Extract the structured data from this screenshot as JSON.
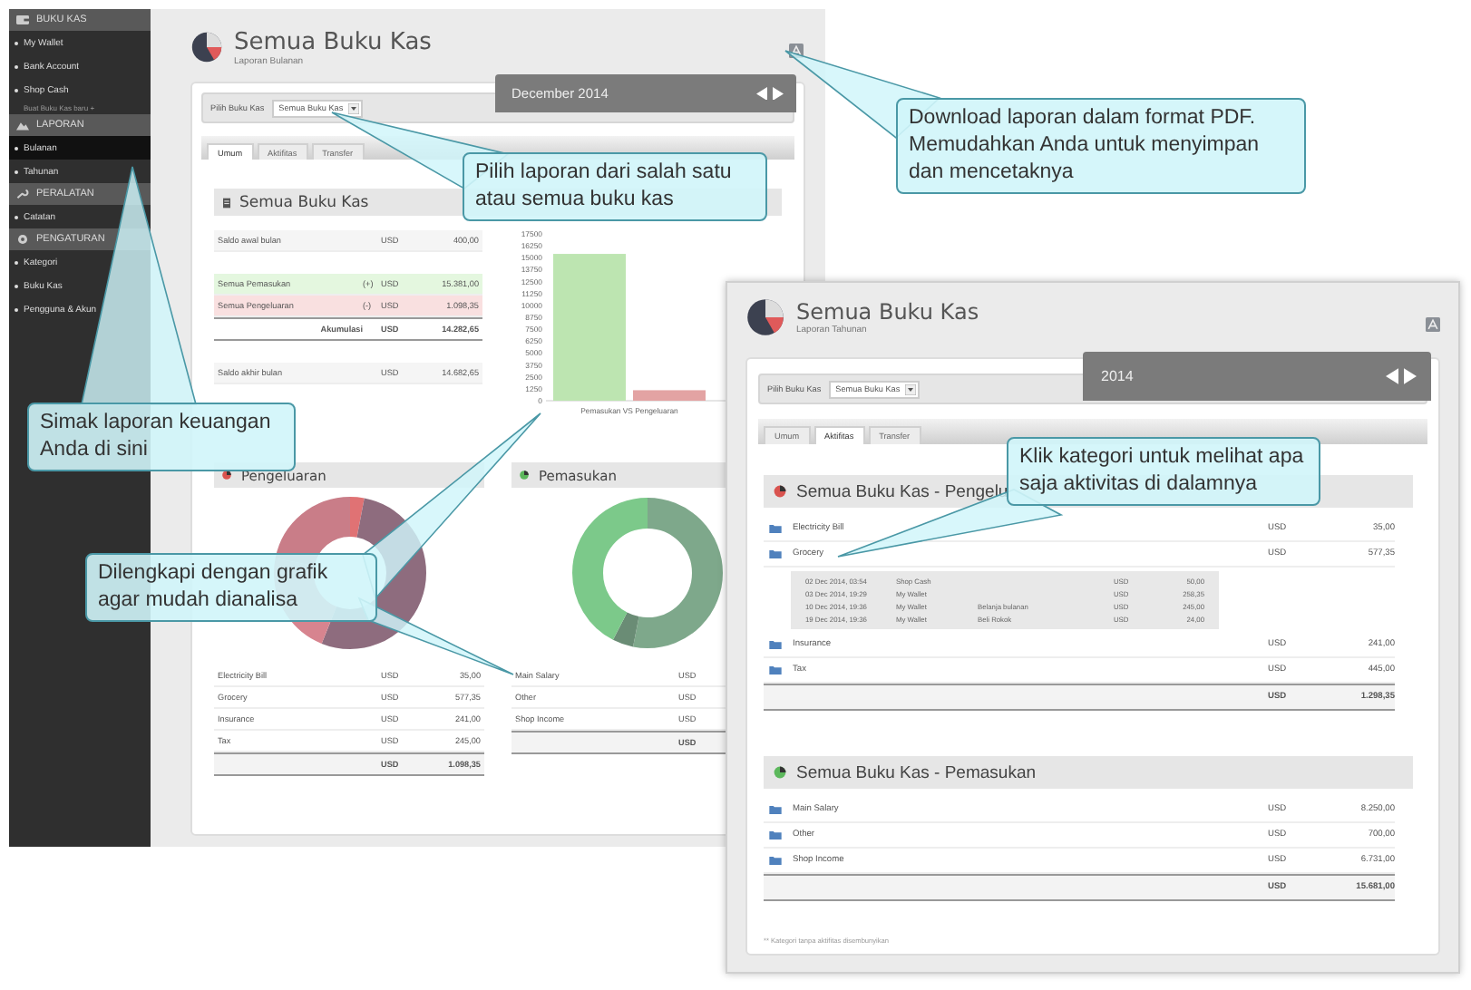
{
  "monthly_report": {
    "sidebar": [
      {
        "title": "BUKU KAS",
        "items": [
          {
            "label": "My Wallet",
            "kind": "link",
            "selected": false
          },
          {
            "label": "Bank Account",
            "kind": "link",
            "selected": false
          },
          {
            "label": "Shop Cash",
            "kind": "link",
            "selected": false
          },
          {
            "label": "Buat Buku Kas baru +",
            "kind": "add",
            "selected": false
          }
        ]
      },
      {
        "title": "LAPORAN",
        "items": [
          {
            "label": "Bulanan",
            "kind": "link",
            "selected": true
          },
          {
            "label": "Tahunan",
            "kind": "link",
            "selected": false
          }
        ]
      },
      {
        "title": "PERALATAN",
        "items": [
          {
            "label": "Catatan",
            "kind": "link",
            "selected": false
          }
        ]
      },
      {
        "title": "PENGATURAN",
        "items": [
          {
            "label": "Kategori",
            "kind": "link",
            "selected": false
          },
          {
            "label": "Buku Kas",
            "kind": "link",
            "selected": false
          },
          {
            "label": "Pengguna & Akun",
            "kind": "link",
            "selected": false
          }
        ]
      }
    ],
    "header": {
      "title": "Semua Buku Kas",
      "subtitle": "Laporan Bulanan"
    },
    "filter": {
      "label": "Pilih Buku Kas",
      "value": "Semua Buku Kas"
    },
    "period": "December 2014",
    "tabs": [
      {
        "label": "Umum",
        "selected": true
      },
      {
        "label": "Aktifitas",
        "selected": false
      },
      {
        "label": "Transfer",
        "selected": false
      }
    ],
    "summary": {
      "title": "Semua Buku Kas",
      "rows": [
        {
          "kind": "opening",
          "label": "Saldo awal bulan",
          "currency": "USD",
          "amount": "400,00"
        },
        {
          "kind": "income",
          "label": "Semua Pemasukan",
          "sign": "(+)",
          "currency": "USD",
          "amount": "15.381,00"
        },
        {
          "kind": "expense",
          "label": "Semua Pengeluaran",
          "sign": "(-)",
          "currency": "USD",
          "amount": "1.098,35"
        },
        {
          "kind": "total",
          "label": "Akumulasi",
          "currency": "USD",
          "amount": "14.282,65"
        },
        {
          "kind": "closing",
          "label": "Saldo akhir bulan",
          "currency": "USD",
          "amount": "14.682,65"
        }
      ]
    },
    "chart_data": {
      "type": "bar",
      "categories": [
        "Pemasukan VS Pengeluaran"
      ],
      "ylim": [
        0,
        17500
      ],
      "yticks": [
        0,
        1250,
        2500,
        3750,
        5000,
        6250,
        7500,
        8750,
        10000,
        11250,
        12500,
        13750,
        15000,
        16250,
        17500
      ],
      "series": [
        {
          "color": "#bde5b1",
          "values": [
            15400
          ]
        },
        {
          "color": "#e3a3a3",
          "values": [
            1100
          ]
        }
      ]
    },
    "expense": {
      "title": "Pengeluaran",
      "rows": [
        {
          "label": "Electricity Bill",
          "currency": "USD",
          "amount": "35,00"
        },
        {
          "label": "Grocery",
          "currency": "USD",
          "amount": "577,35"
        },
        {
          "label": "Insurance",
          "currency": "USD",
          "amount": "241,00"
        },
        {
          "label": "Tax",
          "currency": "USD",
          "amount": "245,00"
        }
      ],
      "total": {
        "currency": "USD",
        "amount": "1.098,35"
      }
    },
    "income": {
      "title": "Pemasukan",
      "rows": [
        {
          "label": "Main Salary",
          "currency": "USD"
        },
        {
          "label": "Other",
          "currency": "USD"
        },
        {
          "label": "Shop Income",
          "currency": "USD"
        }
      ],
      "total": {
        "currency": "USD"
      }
    }
  },
  "yearly_report": {
    "header": {
      "title": "Semua Buku Kas",
      "subtitle": "Laporan Tahunan"
    },
    "filter": {
      "label": "Pilih Buku Kas",
      "value": "Semua Buku Kas"
    },
    "period": "2014",
    "tabs": [
      {
        "label": "Umum",
        "selected": false
      },
      {
        "label": "Aktifitas",
        "selected": true
      },
      {
        "label": "Transfer",
        "selected": false
      }
    ],
    "expense": {
      "title": "Semua Buku Kas - Pengelu",
      "categories": [
        {
          "label": "Electricity Bill",
          "currency": "USD",
          "amount": "35,00"
        },
        {
          "label": "Grocery",
          "currency": "USD",
          "amount": "577,35",
          "activities": [
            {
              "date": "02 Dec 2014, 03:54",
              "wallet": "Shop Cash",
              "currency": "USD",
              "amount": "50,00"
            },
            {
              "date": "03 Dec 2014, 19:29",
              "wallet": "My Wallet",
              "currency": "USD",
              "amount": "258,35"
            },
            {
              "date": "10 Dec 2014, 19:36",
              "wallet": "My Wallet",
              "note": "Belanja bulanan",
              "currency": "USD",
              "amount": "245,00"
            },
            {
              "date": "19 Dec 2014, 19:36",
              "wallet": "My Wallet",
              "note": "Beli Rokok",
              "currency": "USD",
              "amount": "24,00"
            }
          ]
        },
        {
          "label": "Insurance",
          "currency": "USD",
          "amount": "241,00"
        },
        {
          "label": "Tax",
          "currency": "USD",
          "amount": "445,00"
        }
      ],
      "total": {
        "currency": "USD",
        "amount": "1.298,35"
      }
    },
    "income": {
      "title": "Semua Buku Kas - Pemasukan",
      "categories": [
        {
          "label": "Main Salary",
          "currency": "USD",
          "amount": "8.250,00"
        },
        {
          "label": "Other",
          "currency": "USD",
          "amount": "700,00"
        },
        {
          "label": "Shop Income",
          "currency": "USD",
          "amount": "6.731,00"
        }
      ],
      "total": {
        "currency": "USD",
        "amount": "15.681,00"
      }
    },
    "footnote": "** Kategori tanpa aktifitas disembunyikan"
  },
  "callouts": [
    {
      "text": "Download laporan dalam format PDF. Memudahkan Anda untuk menyimpan dan mencetaknya"
    },
    {
      "text": "Pilih laporan dari salah satu atau semua buku kas"
    },
    {
      "text": "Simak laporan keuangan Anda di sini"
    },
    {
      "text": "Dilengkapi dengan grafik agar mudah dianalisa"
    },
    {
      "text": "Klik kategori untuk melihat apa saja aktivitas di dalamnya"
    }
  ]
}
